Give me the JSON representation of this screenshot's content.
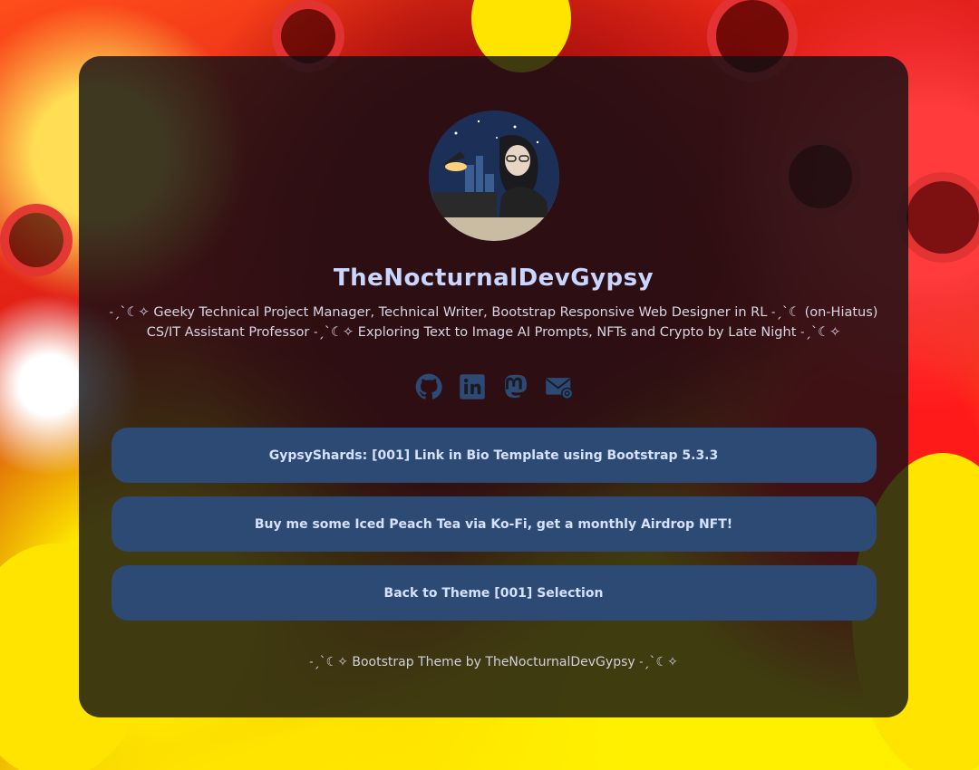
{
  "profile": {
    "name": "TheNocturnalDevGypsy",
    "bio": "˗ˏˋ☾✧ Geeky Technical Project Manager, Technical Writer, Bootstrap Responsive Web Designer in RL ˗ˏˋ☾ (on-Hiatus) CS/IT Assistant Professor ˗ˏˋ☾✧ Exploring Text to Image AI Prompts, NFTs and Crypto by Late Night ˗ˏˋ☾✧"
  },
  "socials": [
    {
      "icon": "github-icon"
    },
    {
      "icon": "linkedin-icon"
    },
    {
      "icon": "mastodon-icon"
    },
    {
      "icon": "email-icon"
    }
  ],
  "links": [
    {
      "label": "GypsyShards: [001] Link in Bio Template using Bootstrap 5.3.3"
    },
    {
      "label": "Buy me some Iced Peach Tea via Ko-Fi, get a monthly Airdrop NFT!"
    },
    {
      "label": "Back to Theme [001] Selection"
    }
  ],
  "footer": {
    "text": "˗ˏˋ☾✧ Bootstrap Theme by TheNocturnalDevGypsy ˗ˏˋ☾✧"
  },
  "colors": {
    "accent": "#2c4a73",
    "icon": "#2c4a73",
    "title": "#c9d6ff"
  }
}
